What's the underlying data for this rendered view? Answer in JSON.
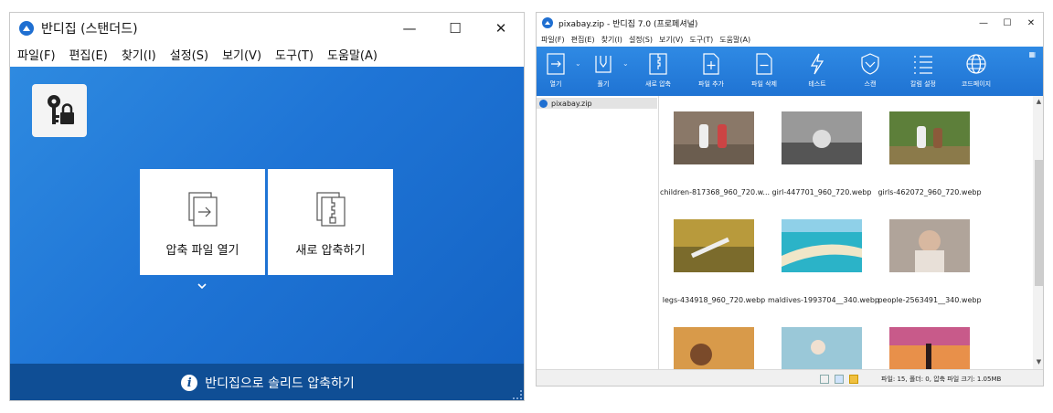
{
  "window1": {
    "title": "반디집 (스탠더드)",
    "menu": [
      "파일(F)",
      "편집(E)",
      "찾기(I)",
      "설정(S)",
      "보기(V)",
      "도구(T)",
      "도움말(A)"
    ],
    "open_label": "압축 파일 열기",
    "new_label": "새로 압축하기",
    "footer": "반디집으로 솔리드 압축하기"
  },
  "window2": {
    "title": "pixabay.zip - 반디집 7.0 (프로페셔널)",
    "menu": [
      "파일(F)",
      "편집(E)",
      "찾기(I)",
      "설정(S)",
      "보기(V)",
      "도구(T)",
      "도움말(A)"
    ],
    "toolbar": [
      "열기",
      "풀기",
      "새로 압축",
      "파일 추가",
      "파일 삭제",
      "테스트",
      "스캔",
      "칼럼 설정",
      "코드페이지"
    ],
    "tree_item": "pixabay.zip",
    "files": [
      "children-817368_960_720.w...",
      "girl-447701_960_720.webp",
      "girls-462072_960_720.webp",
      "legs-434918_960_720.webp",
      "maldives-1993704__340.webp",
      "people-2563491__340.webp",
      "",
      "",
      ""
    ],
    "status": "파일: 15, 폴더: 0, 압축 파일 크기: 1.05MB"
  }
}
